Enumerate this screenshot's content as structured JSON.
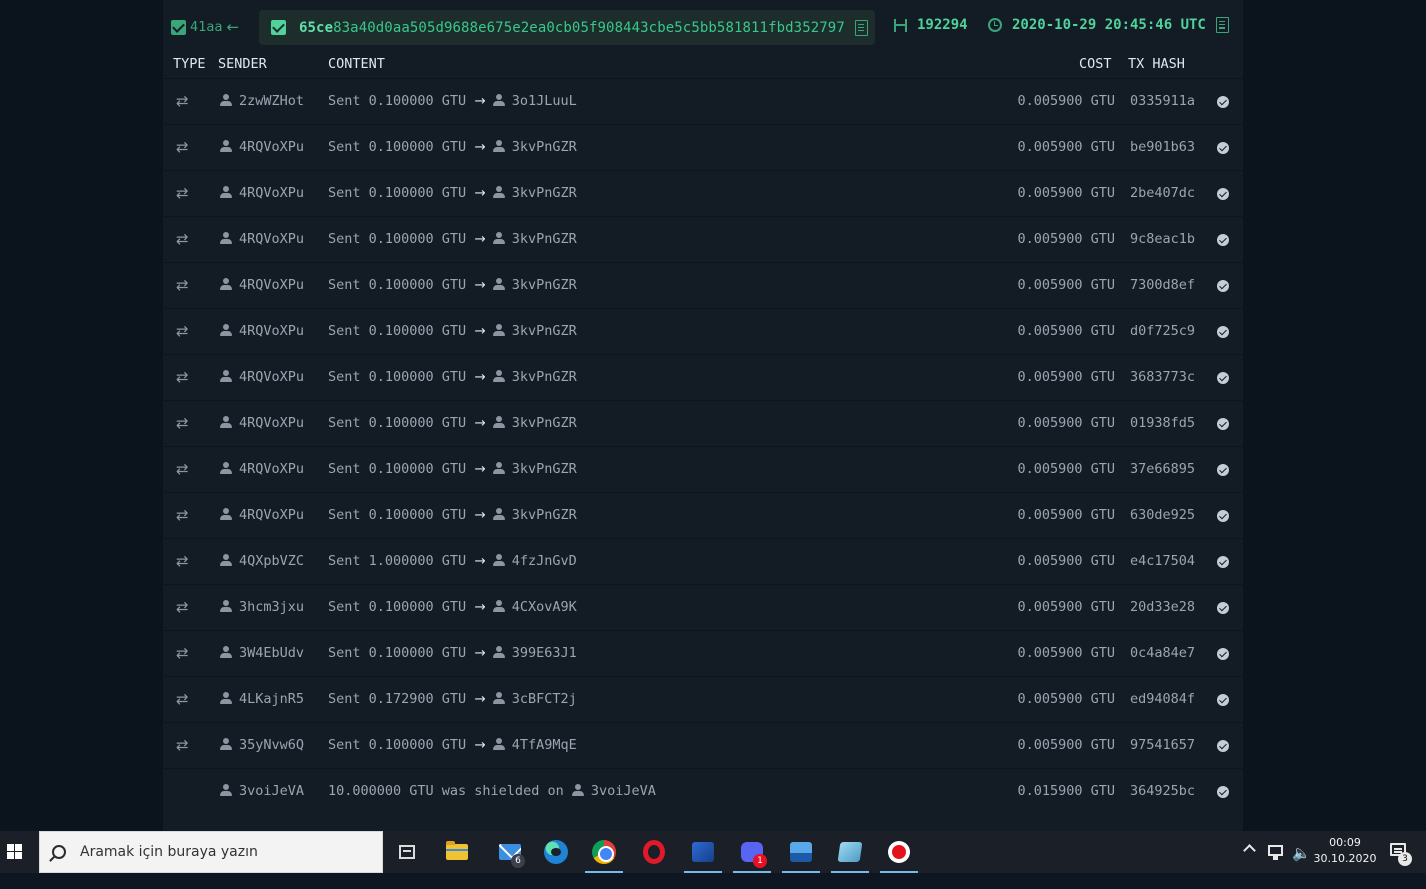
{
  "block": {
    "prev_block_label": "41aa",
    "hash_bold": "65ce",
    "hash_rest": "83a40d0aa505d9688e675e2ea0cb05f908443cbe5c5bb581811fbd352797",
    "height": "192294",
    "timestamp": "2020-10-29 20:45:46 UTC"
  },
  "table": {
    "headers": {
      "type": "TYPE",
      "sender": "SENDER",
      "content": "CONTENT",
      "cost": "COST",
      "tx_hash": "TX HASH"
    },
    "rows": [
      {
        "type": "transfer",
        "sender": "2zwWZHot",
        "content": "Sent 0.100000 GTU",
        "receiver": "3o1JLuuL",
        "cost": "0.005900 GTU",
        "tx_hash": "0335911a"
      },
      {
        "type": "transfer",
        "sender": "4RQVoXPu",
        "content": "Sent 0.100000 GTU",
        "receiver": "3kvPnGZR",
        "cost": "0.005900 GTU",
        "tx_hash": "be901b63"
      },
      {
        "type": "transfer",
        "sender": "4RQVoXPu",
        "content": "Sent 0.100000 GTU",
        "receiver": "3kvPnGZR",
        "cost": "0.005900 GTU",
        "tx_hash": "2be407dc"
      },
      {
        "type": "transfer",
        "sender": "4RQVoXPu",
        "content": "Sent 0.100000 GTU",
        "receiver": "3kvPnGZR",
        "cost": "0.005900 GTU",
        "tx_hash": "9c8eac1b"
      },
      {
        "type": "transfer",
        "sender": "4RQVoXPu",
        "content": "Sent 0.100000 GTU",
        "receiver": "3kvPnGZR",
        "cost": "0.005900 GTU",
        "tx_hash": "7300d8ef"
      },
      {
        "type": "transfer",
        "sender": "4RQVoXPu",
        "content": "Sent 0.100000 GTU",
        "receiver": "3kvPnGZR",
        "cost": "0.005900 GTU",
        "tx_hash": "d0f725c9"
      },
      {
        "type": "transfer",
        "sender": "4RQVoXPu",
        "content": "Sent 0.100000 GTU",
        "receiver": "3kvPnGZR",
        "cost": "0.005900 GTU",
        "tx_hash": "3683773c"
      },
      {
        "type": "transfer",
        "sender": "4RQVoXPu",
        "content": "Sent 0.100000 GTU",
        "receiver": "3kvPnGZR",
        "cost": "0.005900 GTU",
        "tx_hash": "01938fd5"
      },
      {
        "type": "transfer",
        "sender": "4RQVoXPu",
        "content": "Sent 0.100000 GTU",
        "receiver": "3kvPnGZR",
        "cost": "0.005900 GTU",
        "tx_hash": "37e66895"
      },
      {
        "type": "transfer",
        "sender": "4RQVoXPu",
        "content": "Sent 0.100000 GTU",
        "receiver": "3kvPnGZR",
        "cost": "0.005900 GTU",
        "tx_hash": "630de925"
      },
      {
        "type": "transfer",
        "sender": "4QXpbVZC",
        "content": "Sent 1.000000 GTU",
        "receiver": "4fzJnGvD",
        "cost": "0.005900 GTU",
        "tx_hash": "e4c17504"
      },
      {
        "type": "transfer",
        "sender": "3hcm3jxu",
        "content": "Sent 0.100000 GTU",
        "receiver": "4CXovA9K",
        "cost": "0.005900 GTU",
        "tx_hash": "20d33e28"
      },
      {
        "type": "transfer",
        "sender": "3W4EbUdv",
        "content": "Sent 0.100000 GTU",
        "receiver": "399E63J1",
        "cost": "0.005900 GTU",
        "tx_hash": "0c4a84e7"
      },
      {
        "type": "transfer",
        "sender": "4LKajnR5",
        "content": "Sent 0.172900 GTU",
        "receiver": "3cBFCT2j",
        "cost": "0.005900 GTU",
        "tx_hash": "ed94084f"
      },
      {
        "type": "transfer",
        "sender": "35yNvw6Q",
        "content": "Sent 0.100000 GTU",
        "receiver": "4TfA9MqE",
        "cost": "0.005900 GTU",
        "tx_hash": "97541657"
      },
      {
        "type": "shield",
        "sender": "3voiJeVA",
        "content": "10.000000 GTU was shielded on",
        "receiver": "3voiJeVA",
        "cost": "0.015900 GTU",
        "tx_hash": "364925bc"
      }
    ]
  },
  "taskbar": {
    "search_placeholder": "Aramak için buraya yazın",
    "mail_badge": "6",
    "discord_badge": "1",
    "clock_time": "00:09",
    "clock_date": "30.10.2020",
    "notification_count": "3"
  }
}
